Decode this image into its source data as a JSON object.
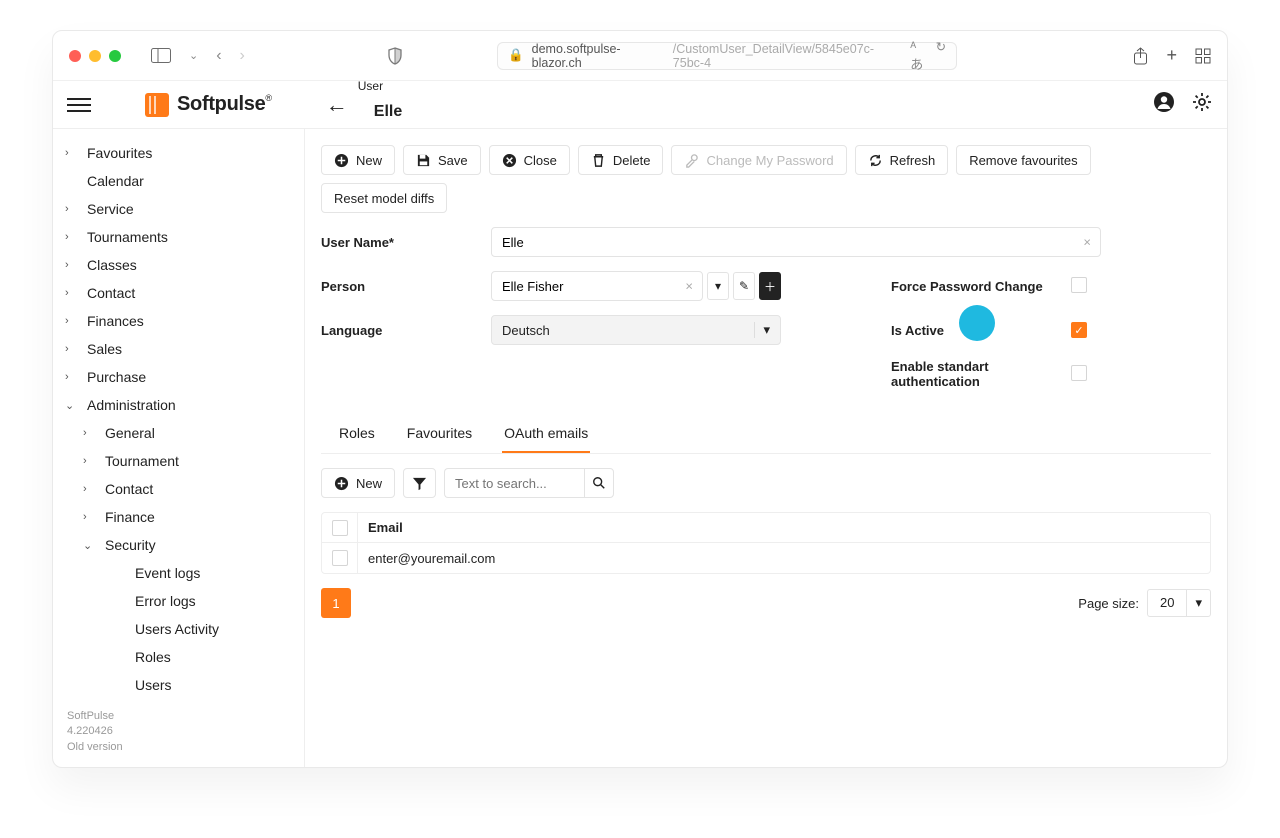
{
  "browser": {
    "url_prefix": "demo.softpulse-blazor.ch",
    "url_path": "/CustomUser_DetailView/5845e07c-75bc-4"
  },
  "app": {
    "logo_text": "Softpulse",
    "logo_reg": "®"
  },
  "breadcrumb": {
    "sup": "User",
    "main": "Elle"
  },
  "sidebar": {
    "items": [
      {
        "label": "Favourites",
        "arrow": "right"
      },
      {
        "label": "Calendar",
        "arrow": ""
      },
      {
        "label": "Service",
        "arrow": "right"
      },
      {
        "label": "Tournaments",
        "arrow": "right"
      },
      {
        "label": "Classes",
        "arrow": "right"
      },
      {
        "label": "Contact",
        "arrow": "right"
      },
      {
        "label": "Finances",
        "arrow": "right"
      },
      {
        "label": "Sales",
        "arrow": "right"
      },
      {
        "label": "Purchase",
        "arrow": "right"
      },
      {
        "label": "Administration",
        "arrow": "down"
      }
    ],
    "admin_children": [
      {
        "label": "General",
        "arrow": "right"
      },
      {
        "label": "Tournament",
        "arrow": "right"
      },
      {
        "label": "Contact",
        "arrow": "right"
      },
      {
        "label": "Finance",
        "arrow": "right"
      },
      {
        "label": "Security",
        "arrow": "down"
      }
    ],
    "security_children": [
      {
        "label": "Event logs"
      },
      {
        "label": "Error logs"
      },
      {
        "label": "Users Activity"
      },
      {
        "label": "Roles"
      },
      {
        "label": "Users"
      }
    ],
    "footer": {
      "name": "SoftPulse",
      "version": "4.220426",
      "old": "Old version"
    }
  },
  "toolbar": {
    "new": "New",
    "save": "Save",
    "close": "Close",
    "del": "Delete",
    "change_pw": "Change My Password",
    "refresh": "Refresh",
    "remove_fav": "Remove favourites",
    "reset_model": "Reset model diffs"
  },
  "form": {
    "username_label": "User Name*",
    "username_value": "Elle",
    "person_label": "Person",
    "person_value": "Elle Fisher",
    "language_label": "Language",
    "language_value": "Deutsch",
    "force_pw_label": "Force Password Change",
    "force_pw_checked": false,
    "is_active_label": "Is Active",
    "is_active_checked": true,
    "enable_std_auth_label": "Enable standart authentication",
    "enable_std_auth_checked": false
  },
  "tabs": {
    "roles": "Roles",
    "favourites": "Favourites",
    "oauth": "OAuth emails",
    "active": "oauth"
  },
  "subtoolbar": {
    "new": "New",
    "search_placeholder": "Text to search..."
  },
  "table": {
    "header": "Email",
    "rows": [
      {
        "email": "enter@youremail.com"
      }
    ]
  },
  "pager": {
    "current": "1",
    "page_size_label": "Page size:",
    "page_size_value": "20"
  }
}
